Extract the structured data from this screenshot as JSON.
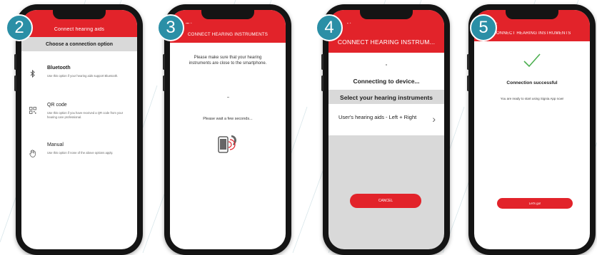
{
  "colors": {
    "brand_red": "#e2232a",
    "badge_teal": "#2b8fa6",
    "grey_panel": "#d9d9d9",
    "phone_frame": "#141414"
  },
  "steps": [
    {
      "number": "2",
      "header": "Connect hearing aids",
      "subheader": "Choose a connection option",
      "options": [
        {
          "icon": "bluetooth-icon",
          "label": "Bluetooth",
          "desc": "Use this option if your hearing aids support Bluetooth."
        },
        {
          "icon": "qr-code-icon",
          "label": "QR code",
          "desc": "Use this option if you have received a QR code from your hearing care professional."
        },
        {
          "icon": "hand-icon",
          "label": "Manual",
          "desc": "Use this option if none of the above options apply."
        }
      ]
    },
    {
      "number": "3",
      "header": "CONNECT HEARING INSTRUMENTS",
      "instruction": "Please make sure that your hearing instruments are close to the smartphone.",
      "wait_text": "Please wait a few seconds..."
    },
    {
      "number": "4",
      "header": "CONNECT HEARING INSTRUM...",
      "connecting": "Connecting to device...",
      "select_title": "Select your hearing instruments",
      "device": "User's hearing aids - Left + Right",
      "cancel": "CANCEL"
    },
    {
      "number": "5",
      "header": "CONNECT HEARING INSTRUMENTS",
      "success_title": "Connection successful",
      "success_text": "You are ready to start using Signia App now!",
      "action": "Let's go!"
    }
  ]
}
